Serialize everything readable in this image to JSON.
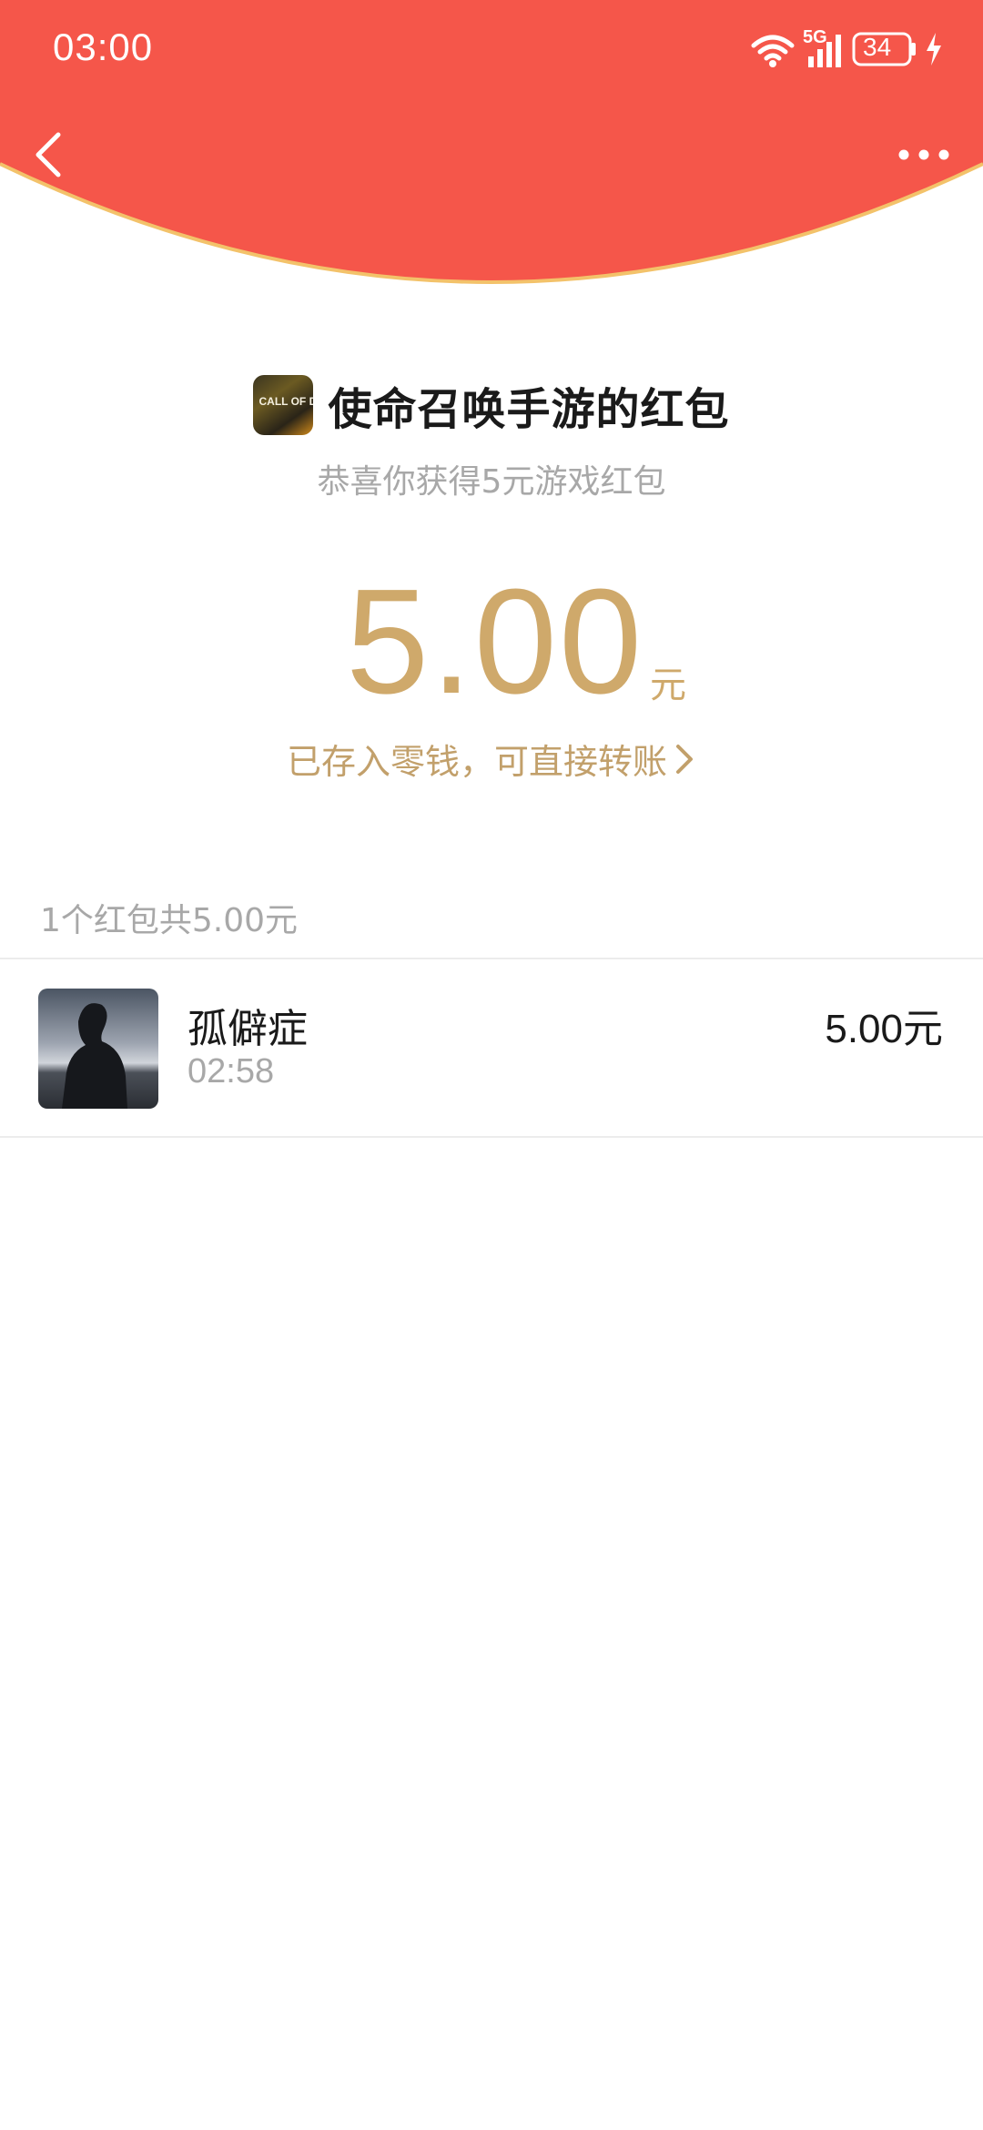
{
  "status_bar": {
    "time": "03:00",
    "network": "5G",
    "battery": "34"
  },
  "header": {
    "back_icon": "chevron-left-icon",
    "more_icon": "more-dots-icon",
    "colors": {
      "background": "#f5564a",
      "edge": "#f3c26a"
    }
  },
  "packet": {
    "game_icon": "call-of-duty-logo",
    "game_icon_text": "CALL OF DUTY",
    "title": "使命召唤手游的红包",
    "subtitle": "恭喜你获得5元游戏红包",
    "amount": "5.00",
    "unit": "元",
    "link_text": "已存入零钱，可直接转账",
    "link_icon": "chevron-right-icon",
    "accent_color": "#cfa96b"
  },
  "summary": {
    "text": "1个红包共5.00元"
  },
  "records": [
    {
      "name": "孤僻症",
      "time": "02:58",
      "amount": "5.00元",
      "avatar": "user-avatar-photo"
    }
  ]
}
